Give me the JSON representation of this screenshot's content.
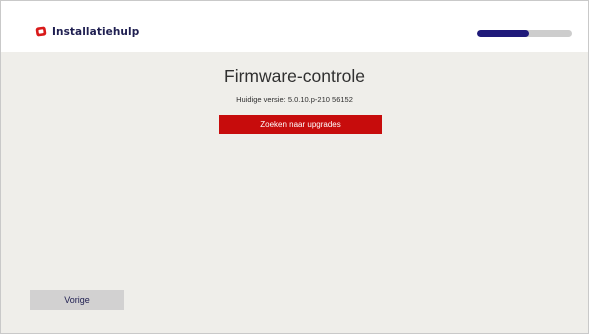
{
  "header": {
    "app_title": "Installatiehulp",
    "logo_icon": "installatiehulp-logo-icon",
    "progress": 0.55,
    "colors": {
      "progress_fill": "#1f1a7a",
      "progress_track": "#cdcdcd",
      "logo": "#d91a1a"
    }
  },
  "main": {
    "title": "Firmware-controle",
    "version_text": "Huidige versie: 5.0.10.p-210 56152",
    "search_button_label": "Zoeken naar upgrades",
    "colors": {
      "search_button": "#c70c0c"
    }
  },
  "footer": {
    "back_button_label": "Vorige"
  }
}
